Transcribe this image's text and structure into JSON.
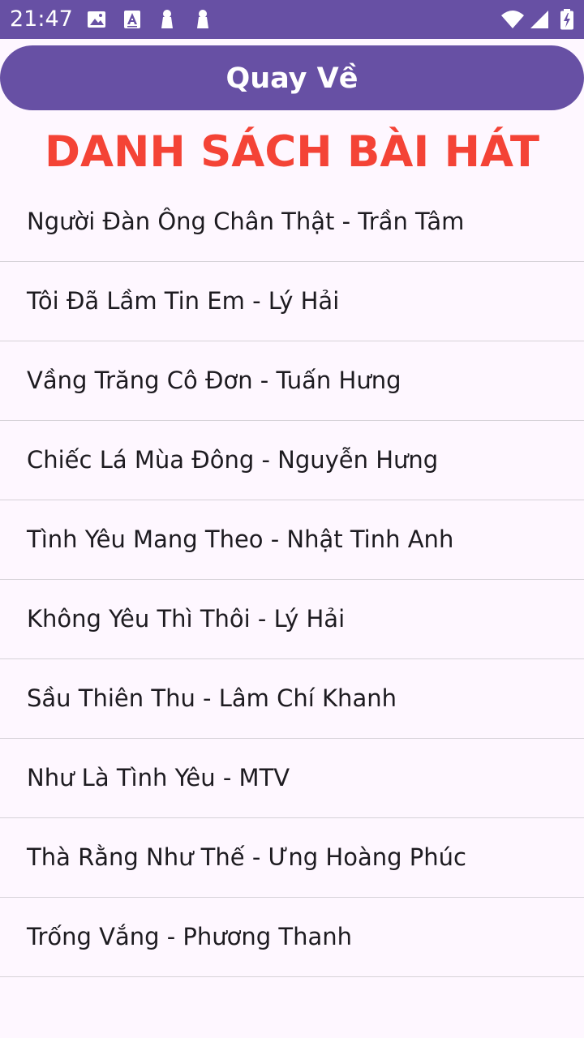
{
  "status_bar": {
    "time": "21:47",
    "left_icons": [
      "image-icon",
      "text-a-icon",
      "pin-icon",
      "pin-icon"
    ],
    "right_icons": [
      "wifi-icon",
      "signal-icon",
      "battery-charging-icon"
    ],
    "background_color": "#6750a4"
  },
  "back_button": {
    "label": "Quay Về",
    "color": "#6750a4"
  },
  "title": {
    "text": "DANH SÁCH BÀI HÁT",
    "color": "#f44336"
  },
  "songs": [
    "Người Đàn Ông Chân Thật - Trần Tâm",
    "Tôi Đã Lầm Tin Em - Lý Hải",
    "Vầng Trăng Cô Đơn - Tuấn Hưng",
    "Chiếc Lá Mùa Đông - Nguyễn Hưng",
    "Tình Yêu Mang Theo - Nhật Tinh Anh",
    "Không Yêu Thì Thôi - Lý Hải",
    "Sầu Thiên Thu - Lâm Chí Khanh",
    "Như Là Tình Yêu - MTV",
    "Thà Rằng Như Thế - Ưng Hoàng Phúc",
    "Trống Vắng - Phương Thanh"
  ]
}
